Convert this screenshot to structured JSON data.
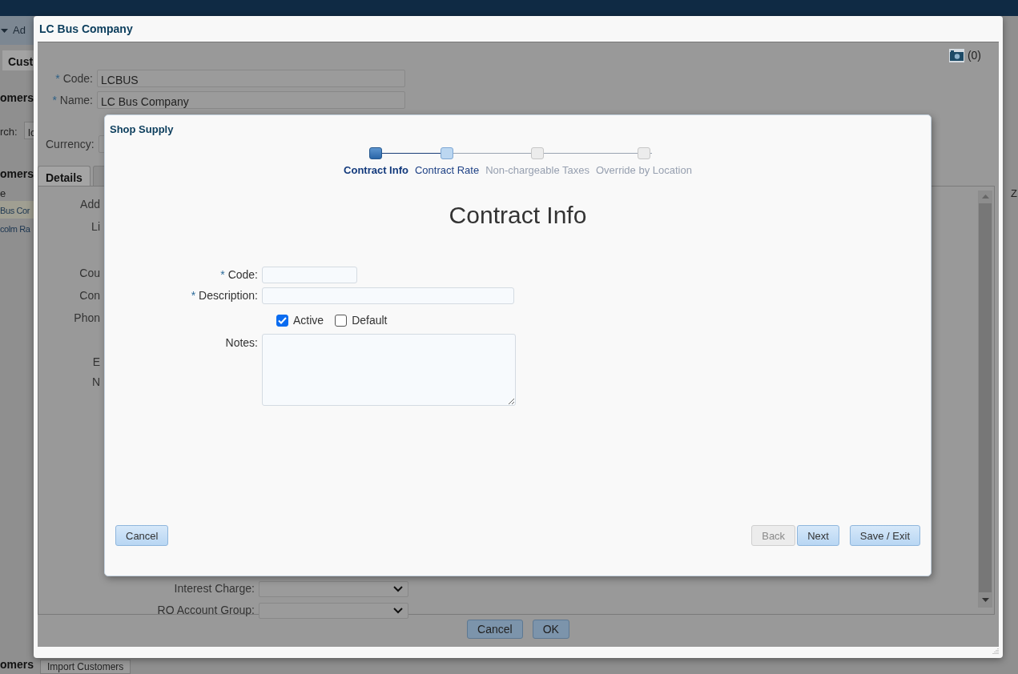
{
  "app": {
    "menu_fragment": "Ad",
    "tab_fragment": "Cust",
    "section_fragment_1": "omers",
    "search_label_fragment": "rch:",
    "search_value_fragment": "lc",
    "section_fragment_2": "omers",
    "column_fragment": "e",
    "rows": [
      {
        "text": "Bus Cor",
        "selected": true
      },
      {
        "text": "colm Ra",
        "selected": false
      }
    ],
    "right_column_fragment": "Z",
    "bottom_tab_fragment": "omers",
    "bottom_button": "Import Customers"
  },
  "customer_dialog": {
    "title": "LC Bus Company",
    "attachments": "(0)",
    "fields": [
      {
        "required_mark": "*",
        "label": "Code:",
        "value": "LCBUS"
      },
      {
        "required_mark": "*",
        "label": "Name:",
        "value": "LC Bus Company"
      }
    ],
    "currency": {
      "label": "Currency:"
    },
    "tabs": [
      {
        "label": "Details",
        "selected": true
      },
      {
        "selected": false
      }
    ],
    "labels": [
      "Add",
      "Li",
      "Cou",
      "Con",
      "Phon",
      "E",
      "N"
    ],
    "selects": [
      {
        "label": "Interest Charge:"
      },
      {
        "label": "RO Account Group:"
      }
    ],
    "buttons": [
      "Cancel",
      "OK"
    ]
  },
  "shop_supply_dialog": {
    "title": "Shop Supply",
    "steps": [
      {
        "label": "Contract Info",
        "selected": true,
        "disabled": false
      },
      {
        "label": "Contract Rate",
        "selected": false,
        "disabled": false
      },
      {
        "label": "Non-chargeable Taxes",
        "selected": false,
        "disabled": true
      },
      {
        "label": "Override by Location",
        "selected": false,
        "disabled": true
      }
    ],
    "heading": "Contract Info",
    "fields": [
      {
        "required_mark": "*",
        "label": "Code:",
        "kind": "short"
      },
      {
        "required_mark": "*",
        "label": "Description:",
        "kind": "long"
      }
    ],
    "checkboxes": [
      {
        "label": "Active",
        "checked": true
      },
      {
        "label": "Default",
        "checked": false
      }
    ],
    "notes": {
      "label": "Notes:"
    },
    "cancel": "Cancel",
    "buttons": [
      {
        "label": "Back",
        "disabled": true
      },
      {
        "label": "Next",
        "disabled": false
      },
      {
        "label": "Save / Exit",
        "disabled": false
      }
    ]
  }
}
